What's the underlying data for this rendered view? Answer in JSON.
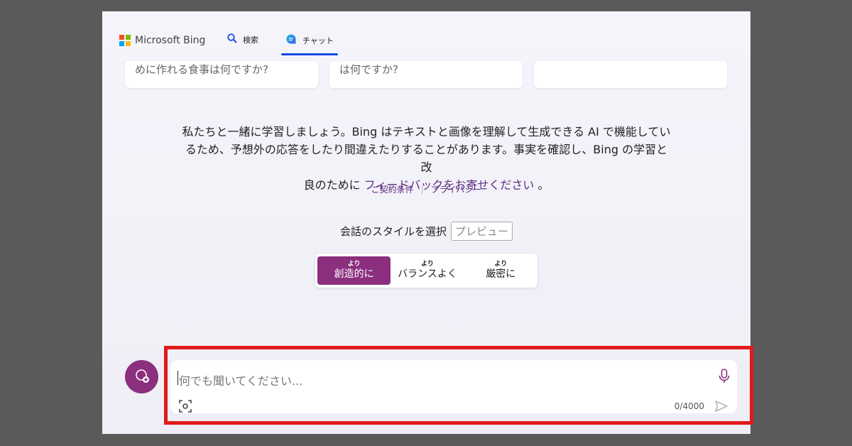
{
  "header": {
    "logo_text": "Microsoft Bing",
    "nav": {
      "search_label": "検索",
      "chat_label": "チャット"
    }
  },
  "suggestions": [
    {
      "text": "めに作れる食事は何ですか?"
    },
    {
      "text": "は何ですか?"
    },
    {
      "text": ""
    }
  ],
  "disclaimer": {
    "line1": "私たちと一緒に学習しましょう。Bing はテキストと画像を理解して生成できる AI で機能してい",
    "line2": "るため、予想外の応答をしたり間違えたりすることがあります。事実を確認し、Bing の学習と改",
    "line3_prefix": "良のために ",
    "feedback_link": "フィードバックをお寄せください",
    "line3_suffix": " 。"
  },
  "legal": {
    "terms": "ご契約条件",
    "privacy": "プライバシー"
  },
  "style_selector": {
    "title": "会話のスタイルを選択",
    "preview_badge": "プレビュー",
    "options": [
      {
        "small": "より",
        "label": "創造的に",
        "active": true
      },
      {
        "small": "より",
        "label": "バランスよく",
        "active": false
      },
      {
        "small": "より",
        "label": "厳密に",
        "active": false
      }
    ]
  },
  "composer": {
    "placeholder": "何でも聞いてください...",
    "counter": "0/4000"
  },
  "colors": {
    "accent": "#8b2f7e",
    "highlight_box": "#e11a1a",
    "nav_underline": "#174ae4"
  },
  "icons": {
    "search": "search-icon",
    "chat": "chat-icon",
    "new_topic": "new-topic-icon",
    "mic": "mic-icon",
    "visual_search": "visual-search-icon",
    "send": "send-icon"
  }
}
